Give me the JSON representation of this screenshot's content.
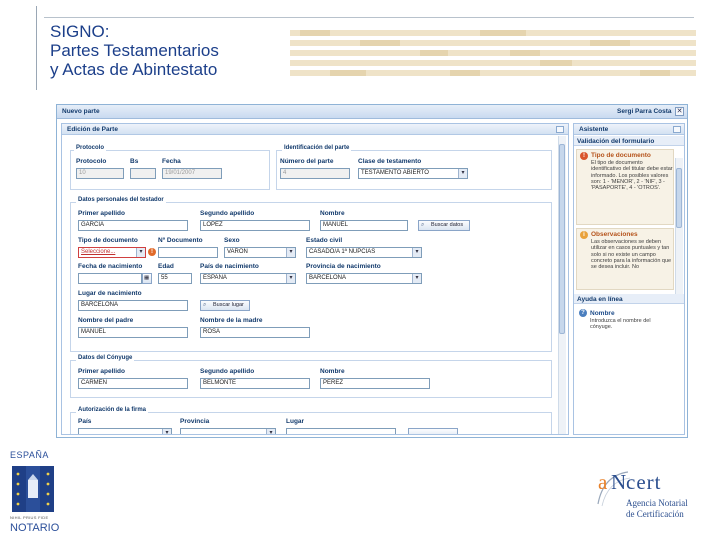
{
  "slide": {
    "title_line1": "SIGNO:",
    "title_line2": "Partes Testamentarios",
    "title_line3": "y Actas de Abintestato"
  },
  "window": {
    "title": "Nuevo parte",
    "user": "Sergi Parra Costa",
    "close": "✕"
  },
  "form": {
    "panel_title": "Edición de Parte",
    "protocolo": {
      "legend": "Protocolo",
      "protocolo_label": "Protocolo",
      "protocolo_value": "10",
      "bis_label": "Bs",
      "fecha_label": "Fecha",
      "fecha_value": "19/01/2007"
    },
    "identificacion": {
      "legend": "Identificación del parte",
      "numero_label": "Número del parte",
      "numero_value": "4",
      "clase_label": "Clase de testamento",
      "clase_value": "TESTAMENTO ABIERTO"
    },
    "testador": {
      "legend": "Datos personales del testador",
      "primer_apellido_label": "Primer apellido",
      "primer_apellido_value": "GARCIA",
      "segundo_apellido_label": "Segundo apellido",
      "segundo_apellido_value": "LOPEZ",
      "nombre_label": "Nombre",
      "nombre_value": "MANUEL",
      "buscar_label": "Buscar datos",
      "tipo_doc_label": "Tipo de documento",
      "tipo_doc_value": "Seleccione...",
      "num_doc_label": "Nº Documento",
      "sexo_label": "Sexo",
      "sexo_value": "VARÓN",
      "estado_civil_label": "Estado civil",
      "estado_civil_value": "CASADO/A 1ª NUPCIAS",
      "fecha_nac_label": "Fecha de nacimiento",
      "edad_label": "Edad",
      "edad_value": "55",
      "pais_nac_label": "País de nacimiento",
      "pais_nac_value": "ESPAÑA",
      "provincia_nac_label": "Provincia de nacimiento",
      "provincia_nac_value": "BARCELONA",
      "lugar_nac_label": "Lugar de nacimiento",
      "lugar_nac_value": "BARCELONA",
      "buscar_lugar_label": "Buscar lugar",
      "padre_label": "Nombre del padre",
      "padre_value": "MANUEL",
      "madre_label": "Nombre de la madre",
      "madre_value": "ROSA"
    },
    "conyuge": {
      "legend": "Datos del Cónyuge",
      "primer_apellido_label": "Primer apellido",
      "primer_apellido_value": "CARMEN",
      "segundo_apellido_label": "Segundo apellido",
      "segundo_apellido_value": "BELMONTE",
      "nombre_label": "Nombre",
      "nombre_value": "PEREZ"
    },
    "autorizacion": {
      "legend": "Autorización de la firma",
      "pais_label": "País",
      "provincia_label": "Provincia",
      "lugar_label": "Lugar"
    }
  },
  "assistant": {
    "title": "Asistente",
    "validation_header": "Validación del formulario",
    "error_title": "Tipo de documento",
    "error_text": "El tipo de documento identificativo del titular debe estar informado. Los posibles valores son: 1 - 'MENOR', 2 - 'NIF', 3 - 'PASAPORTE', 4 - 'OTROS'.",
    "obs_title": "Observaciones",
    "obs_text": "Las observaciones se deben utilizar en casos puntuales y tan solo si no existe un campo concreto para la información que se desea incluir. No",
    "help_header": "Ayuda en línea",
    "help_title": "Nombre",
    "help_text": "Introduzca el nombre del cónyuge."
  },
  "logos": {
    "left_text_top": "ESPAÑA",
    "left_motto": "NIHIL PRIUS FIDE",
    "left_text_bottom": "NOTARIO",
    "right_brand_a": "a",
    "right_brand_n": "N",
    "right_brand_rest": "cert",
    "right_line1": "Agencia Notarial",
    "right_line2": "de Certificación"
  },
  "colors": {
    "title": "#1c3f8a",
    "window_border": "#8fb3d6",
    "label": "#123a6c",
    "error": "#e06a2a",
    "brand_orange": "#e8812a",
    "brand_blue": "#2c4f8f"
  },
  "icons": {
    "close": "close-icon",
    "error": "error-icon",
    "observation": "info-icon",
    "help": "help-icon",
    "search": "search-icon",
    "calendar": "calendar-icon"
  }
}
